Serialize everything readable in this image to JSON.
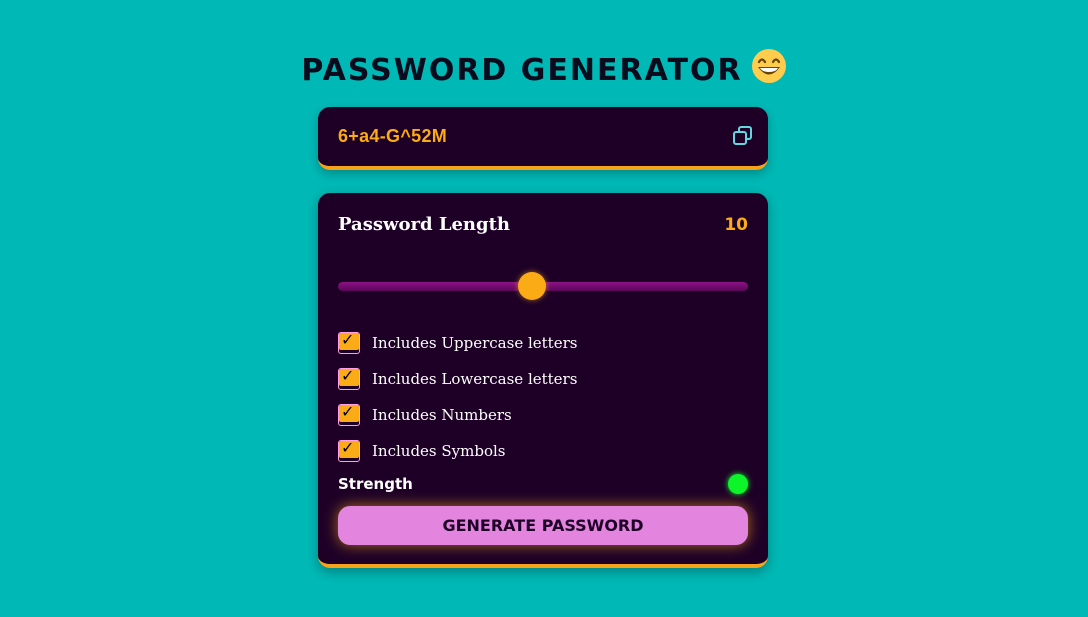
{
  "header": {
    "title": "PASSWORD GENERATOR",
    "emoji": "😄"
  },
  "display": {
    "password": "6+a4-G^52M",
    "copy_icon": "copy-icon"
  },
  "length": {
    "label": "Password Length",
    "value": "10",
    "slider_value": 10,
    "slider_min": 1,
    "slider_max": 20
  },
  "options": [
    {
      "label": "Includes Uppercase letters",
      "checked": true
    },
    {
      "label": "Includes Lowercase letters",
      "checked": true
    },
    {
      "label": "Includes Numbers",
      "checked": true
    },
    {
      "label": "Includes Symbols",
      "checked": true
    }
  ],
  "strength": {
    "label": "Strength",
    "color": "#0df52a"
  },
  "generate": {
    "label": "GENERATE PASSWORD"
  },
  "colors": {
    "background": "#00b9b6",
    "card": "#1e0027",
    "accent": "#fbab16",
    "button": "#e384df"
  }
}
